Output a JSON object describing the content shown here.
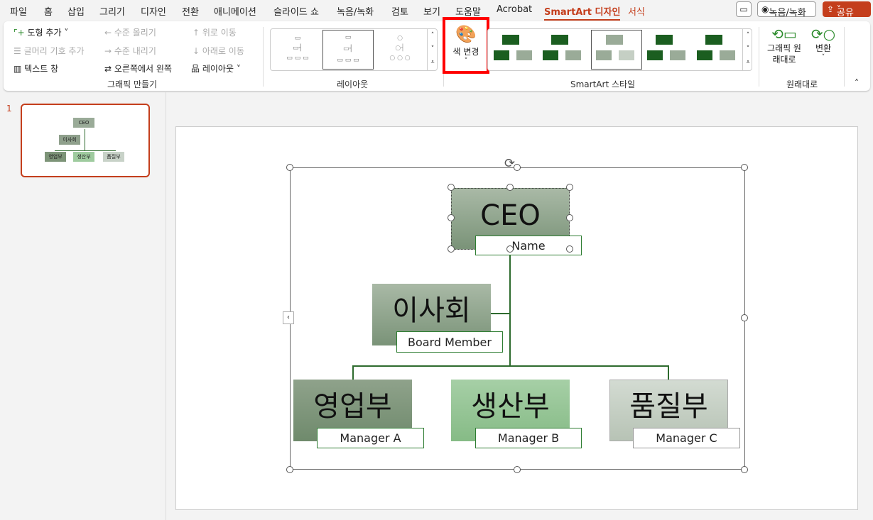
{
  "menu": {
    "tabs": [
      "파일",
      "홈",
      "삽입",
      "그리기",
      "디자인",
      "전환",
      "애니메이션",
      "슬라이드 쇼",
      "녹음/녹화",
      "검토",
      "보기",
      "도움말",
      "Acrobat",
      "SmartArt 디자인",
      "서식"
    ],
    "active": "SmartArt 디자인",
    "record": "녹음/녹화",
    "share": "공유"
  },
  "ribbon": {
    "create": {
      "add_shape": "도형 추가",
      "add_bullet": "글머리 기호 추가",
      "text_pane": "텍스트 창",
      "promote": "수준 올리기",
      "demote": "수준 내리기",
      "rtl": "오른쪽에서 왼쪽",
      "move_up": "위로 이동",
      "move_down": "아래로 이동",
      "layout": "레이아웃",
      "label": "그래픽 만들기"
    },
    "layouts": {
      "label": "레이아웃"
    },
    "colors": {
      "label": "색 변경"
    },
    "styles": {
      "label": "SmartArt 스타일"
    },
    "reset": {
      "reset_graphic": "그래픽 원래대로",
      "convert": "변환",
      "label": "원래대로"
    }
  },
  "slides": {
    "number": "1",
    "thumb": {
      "ceo": "CEO",
      "board": "이사회",
      "depts": [
        "영업부",
        "생산부",
        "품질부"
      ]
    }
  },
  "smartart": {
    "ceo": {
      "title": "CEO",
      "sub": "Name"
    },
    "board": {
      "title": "이사회",
      "sub": "Board Member"
    },
    "depts": [
      {
        "title": "영업부",
        "sub": "Manager A"
      },
      {
        "title": "생산부",
        "sub": "Manager B"
      },
      {
        "title": "품질부",
        "sub": "Manager C"
      }
    ]
  },
  "colors": {
    "accent": "#c43e1c",
    "line": "#2e6b2e",
    "highlight": "#ff0000"
  }
}
